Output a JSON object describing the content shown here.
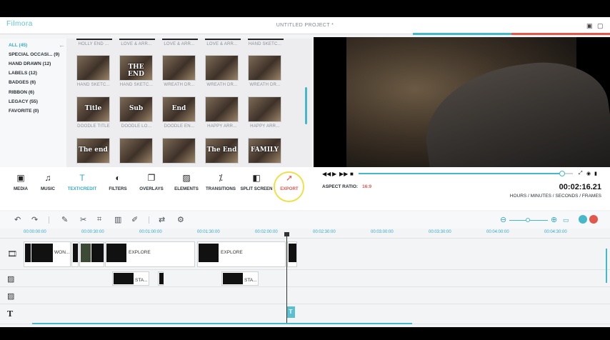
{
  "app": {
    "logo": "Filmora",
    "window_title": "UNTITLED PROJECT *",
    "colors": {
      "accent": "#45b8c9",
      "export": "#e4584c"
    }
  },
  "categories": [
    {
      "label": "ALL (45)",
      "active": true
    },
    {
      "label": "SPECIAL OCCASI...  (9)"
    },
    {
      "label": "HAND DRAWN (12)"
    },
    {
      "label": "LABELS (12)"
    },
    {
      "label": "BADGES (6)"
    },
    {
      "label": "RIBBON (6)"
    },
    {
      "label": "LEGACY (55)"
    },
    {
      "label": "FAVORITE (0)"
    }
  ],
  "library": {
    "top_labels": [
      "HOLLY END ...",
      "LOVE & ARR...",
      "LOVE & ARR...",
      "LOVE & ARR...",
      "HAND SKETC..."
    ],
    "rows": [
      [
        {
          "thumb_text": "",
          "label": "HAND SKETC..."
        },
        {
          "thumb_text": "THE END",
          "label": "HAND SKETC..."
        },
        {
          "thumb_text": "",
          "label": "WREATH DR..."
        },
        {
          "thumb_text": "",
          "label": "WREATH DR..."
        },
        {
          "thumb_text": "",
          "label": "WREATH DR..."
        }
      ],
      [
        {
          "thumb_text": "Title",
          "label": "DOODLE TITLE"
        },
        {
          "thumb_text": "Sub",
          "label": "DOODLE LO..."
        },
        {
          "thumb_text": "End",
          "label": "DOODLE EN..."
        },
        {
          "thumb_text": "",
          "label": "HAPPY ARR..."
        },
        {
          "thumb_text": "",
          "label": "HAPPY ARR..."
        }
      ],
      [
        {
          "thumb_text": "The end",
          "label": ""
        },
        {
          "thumb_text": "",
          "label": ""
        },
        {
          "thumb_text": "",
          "label": ""
        },
        {
          "thumb_text": "The End",
          "label": ""
        },
        {
          "thumb_text": "FAMILY",
          "label": ""
        }
      ]
    ]
  },
  "tools": [
    {
      "label": "MEDIA",
      "icon": "media-icon",
      "glyph": "▣"
    },
    {
      "label": "MUSIC",
      "icon": "music-icon",
      "glyph": "♫"
    },
    {
      "label": "TEXT/CREDIT",
      "icon": "text-icon",
      "glyph": "T",
      "active": true
    },
    {
      "label": "FILTERS",
      "icon": "filters-icon",
      "glyph": "◐"
    },
    {
      "label": "OVERLAYS",
      "icon": "overlays-icon",
      "glyph": "❐"
    },
    {
      "label": "ELEMENTS",
      "icon": "elements-icon",
      "glyph": "▨"
    },
    {
      "label": "TRANSITIONS",
      "icon": "transitions-icon",
      "glyph": "⁒"
    },
    {
      "label": "SPLIT SCREEN",
      "icon": "split-screen-icon",
      "glyph": "◧"
    },
    {
      "label": "EXPORT",
      "icon": "export-icon",
      "glyph": "➚",
      "export": true
    }
  ],
  "player": {
    "aspect_label": "ASPECT RATIO:",
    "aspect_value": "16:9",
    "timecode": "00:02:16.21",
    "timecode_label": "HOURS / MINUTES / SECONDS / FRAMES",
    "progress": 0.95
  },
  "ruler": [
    "00:00:00:00",
    "00:00:30:00",
    "00:01:00:00",
    "00:01:30:00",
    "00:02:00:00",
    "00:02:30:00",
    "00:03:00:00",
    "00:03:30:00",
    "00:04:00:00",
    "00:04:30:00"
  ],
  "timeline": {
    "video_clips": [
      "WON...",
      "EXPLORE",
      "EXPLORE"
    ],
    "overlay_clips": [
      "STA...",
      "STA..."
    ],
    "text_clip": "T"
  }
}
